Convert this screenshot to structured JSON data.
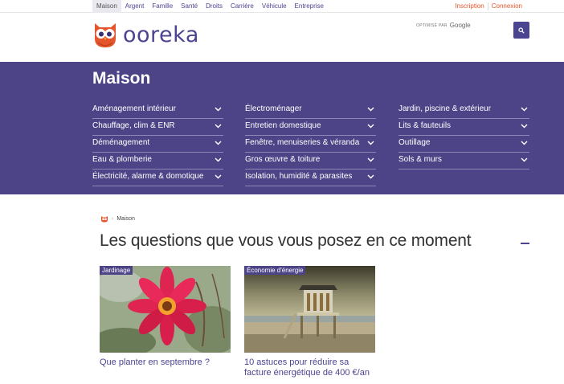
{
  "topnav": {
    "categories": [
      "Maison",
      "Argent",
      "Famille",
      "Santé",
      "Droits",
      "Carrière",
      "Véhicule",
      "Entreprise"
    ],
    "signup": "Inscription",
    "login": "Connexion"
  },
  "header": {
    "logo_text": "ooreka",
    "search_optimized": "OPTIMISÉ PAR",
    "search_google": "Google"
  },
  "band": {
    "title": "Maison",
    "columns": [
      [
        "Aménagement intérieur",
        "Chauffage, clim & ENR",
        "Déménagement",
        "Eau & plomberie",
        "Électricité, alarme & domotique"
      ],
      [
        "Électroménager",
        "Entretien domestique",
        "Fenêtre, menuiseries & véranda",
        "Gros œuvre & toiture",
        "Isolation, humidité & parasites"
      ],
      [
        "Jardin, piscine & extérieur",
        "Lits & fauteuils",
        "Outillage",
        "Sols & murs"
      ]
    ]
  },
  "breadcrumb": {
    "current": "Maison"
  },
  "section": {
    "title": "Les questions que vous vous posez en ce moment"
  },
  "cards": [
    {
      "tag": "Jardinage",
      "caption": "Que planter en septembre ?"
    },
    {
      "tag": "Économie d'énergie",
      "caption": "10 astuces pour réduire sa facture énergétique de 400 €/an"
    }
  ],
  "colors": {
    "brand": "#4b4490",
    "band": "#4d4487",
    "accent": "#e4552b"
  }
}
